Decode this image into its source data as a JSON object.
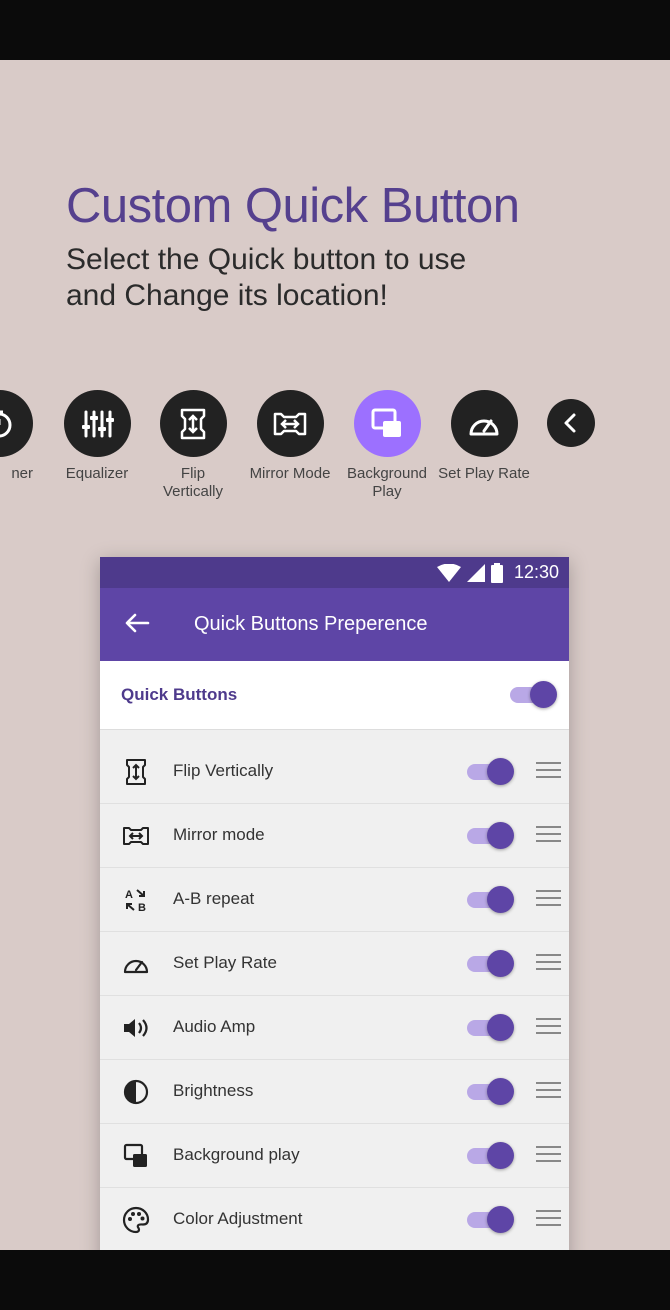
{
  "promo": {
    "headline": "Custom Quick Button",
    "subline": "Select the Quick button to use\nand Change its location!"
  },
  "strip": [
    {
      "label": "ner",
      "icon": "timer-icon",
      "active": false
    },
    {
      "label": "Equalizer",
      "icon": "equalizer-icon",
      "active": false
    },
    {
      "label": "Flip\nVertically",
      "icon": "flip-vertical-icon",
      "active": false
    },
    {
      "label": "Mirror Mode",
      "icon": "mirror-icon",
      "active": false
    },
    {
      "label": "Background\nPlay",
      "icon": "background-play-icon",
      "active": true
    },
    {
      "label": "Set Play Rate",
      "icon": "speedometer-icon",
      "active": false
    },
    {
      "label": "",
      "icon": "chevron-left-icon",
      "active": false
    }
  ],
  "status": {
    "time": "12:30"
  },
  "appbar": {
    "title": "Quick Buttons Preperence"
  },
  "quick_buttons": {
    "label": "Quick Buttons",
    "enabled": true
  },
  "rows": [
    {
      "label": "Flip Vertically",
      "icon": "flip-vertical-icon",
      "enabled": true
    },
    {
      "label": "Mirror mode",
      "icon": "mirror-icon",
      "enabled": true
    },
    {
      "label": "A-B repeat",
      "icon": "ab-repeat-icon",
      "enabled": true
    },
    {
      "label": "Set Play Rate",
      "icon": "speedometer-icon",
      "enabled": true
    },
    {
      "label": "Audio Amp",
      "icon": "volume-icon",
      "enabled": true
    },
    {
      "label": "Brightness",
      "icon": "brightness-icon",
      "enabled": true
    },
    {
      "label": "Background play",
      "icon": "background-play-icon",
      "enabled": true
    },
    {
      "label": "Color Adjustment",
      "icon": "palette-icon",
      "enabled": true
    }
  ],
  "colors": {
    "accent": "#5e45a6",
    "headline": "#55408e",
    "active_button": "#9c70ff",
    "background": "#d9cbc8"
  }
}
